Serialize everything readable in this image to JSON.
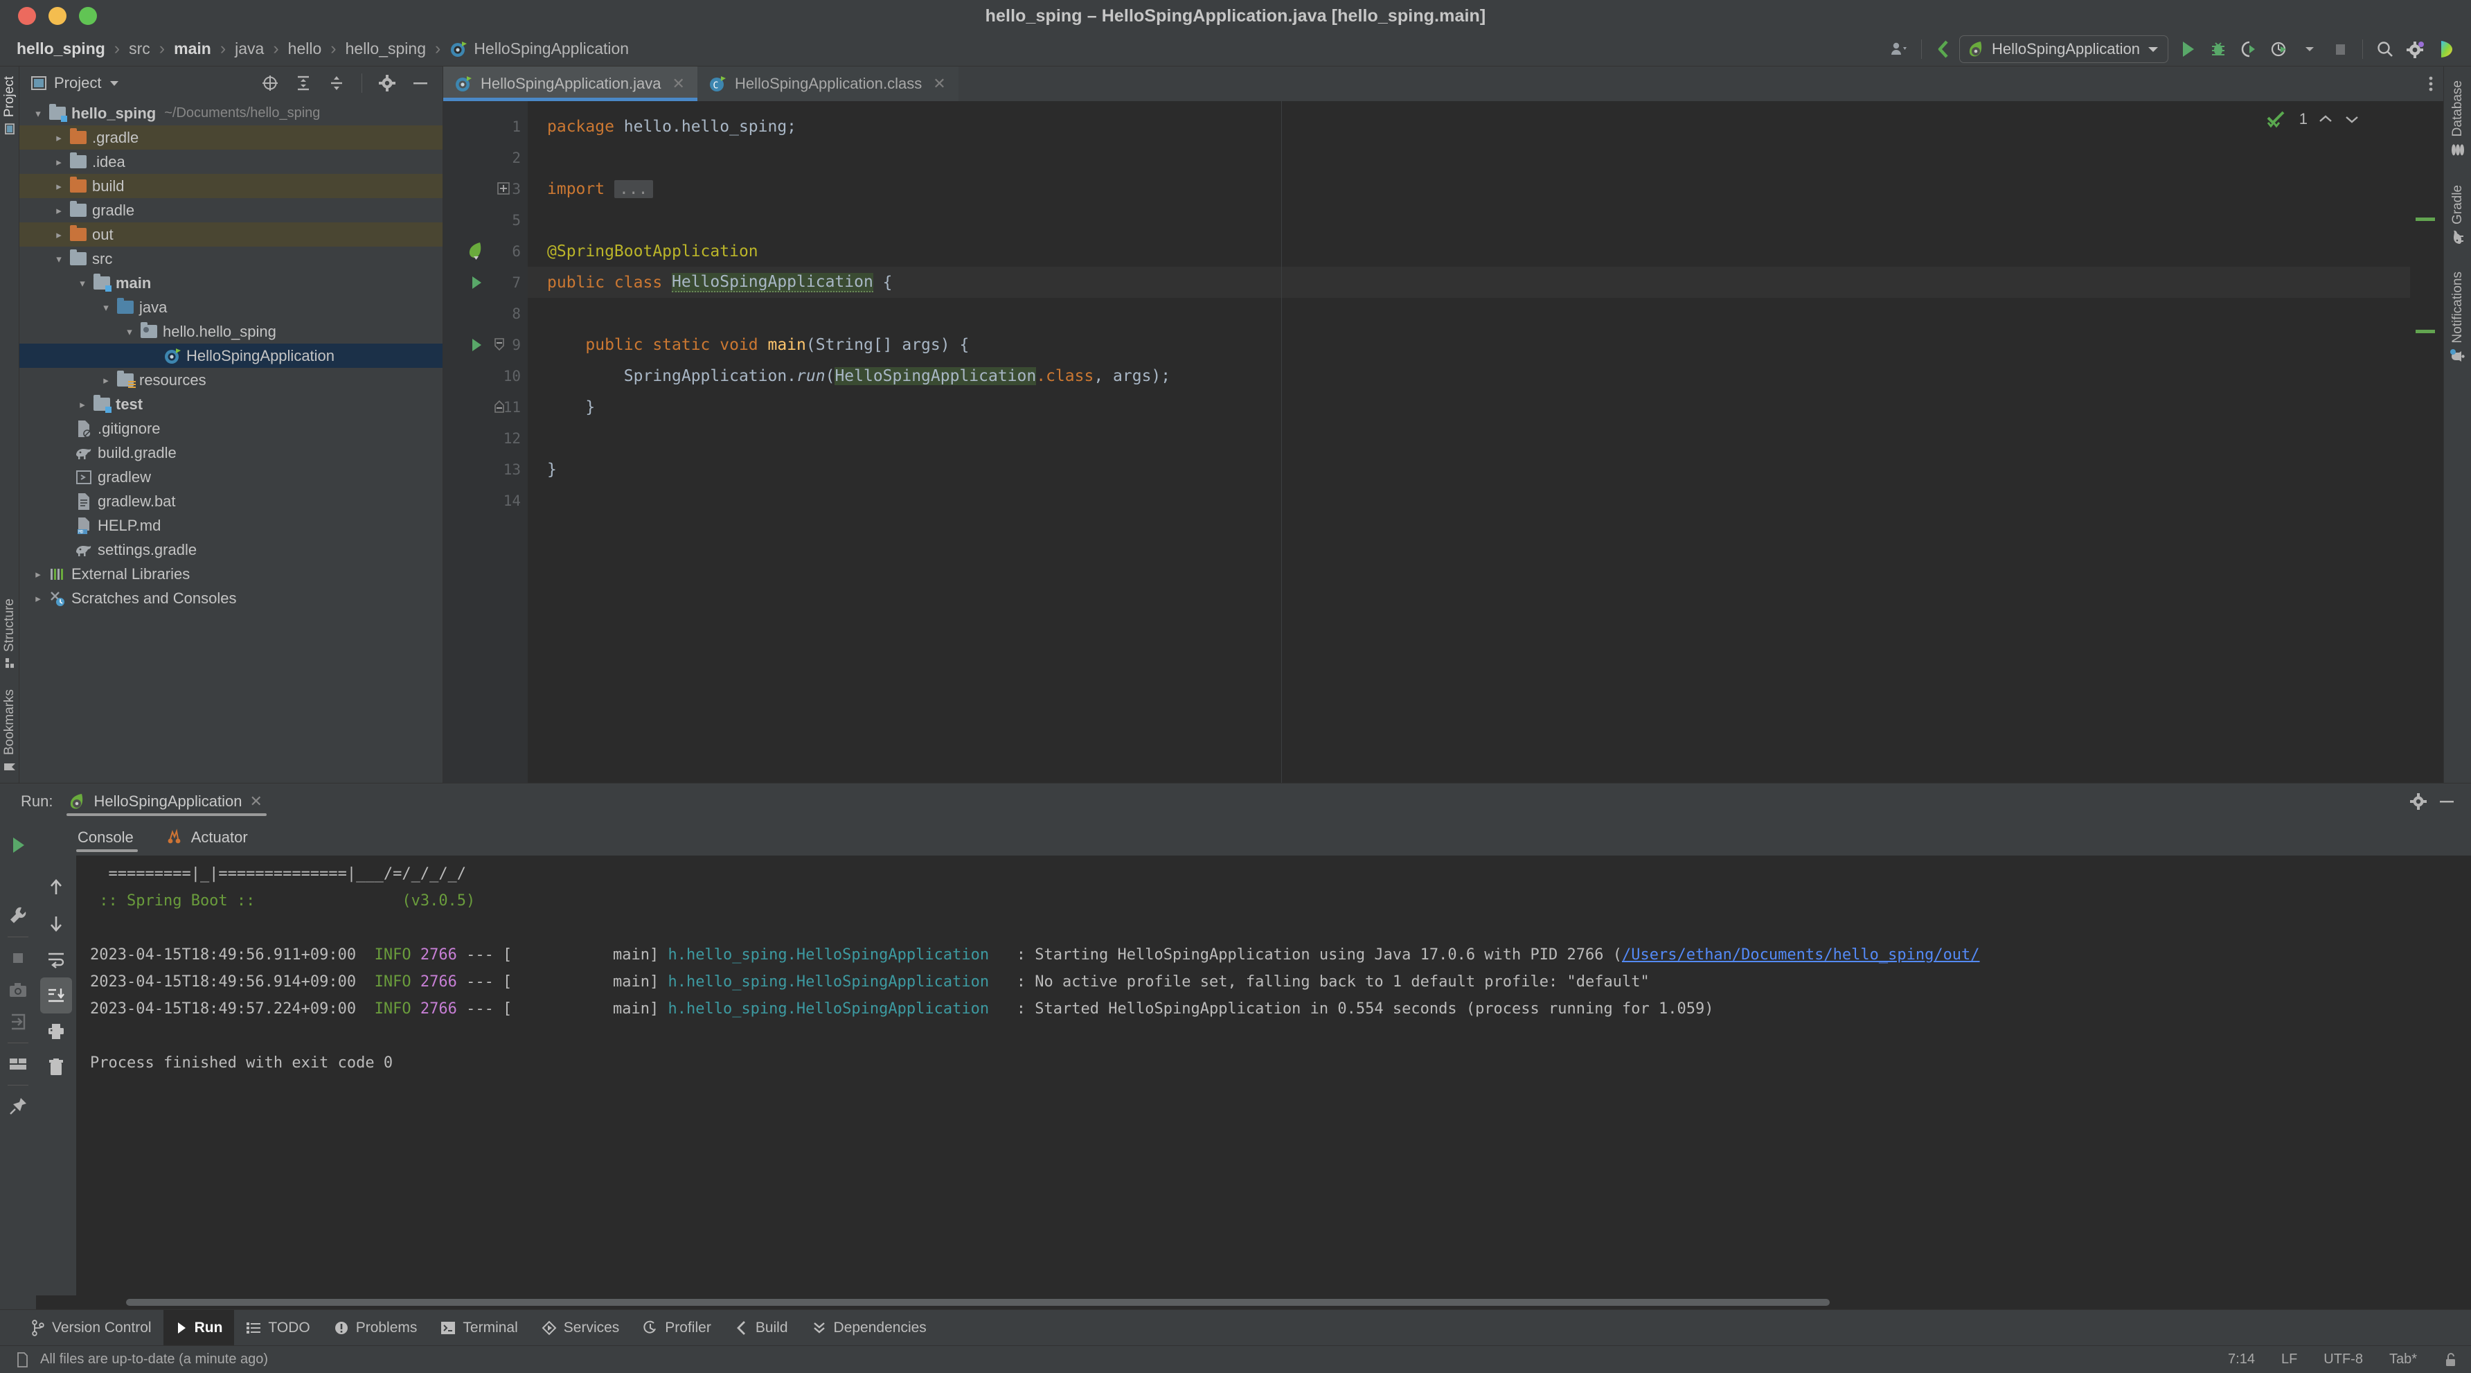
{
  "window": {
    "title": "hello_sping – HelloSpingApplication.java [hello_sping.main]"
  },
  "breadcrumb": {
    "items": [
      {
        "label": "hello_sping",
        "bold": true
      },
      {
        "label": "src",
        "bold": false
      },
      {
        "label": "main",
        "bold": true
      },
      {
        "label": "java",
        "bold": false
      },
      {
        "label": "hello",
        "bold": false
      },
      {
        "label": "hello_sping",
        "bold": false
      },
      {
        "label": "HelloSpingApplication",
        "bold": false,
        "icon": "spring-class-icon"
      }
    ],
    "separator": "›"
  },
  "toolbar": {
    "run_config": "HelloSpingApplication",
    "icons": [
      "account-icon",
      "updates-icon",
      "run-icon",
      "debug-icon",
      "run-with-coverage-icon",
      "profiler-icon",
      "stop-icon",
      "search-icon",
      "settings-icon",
      "ai-assistant-icon"
    ]
  },
  "project_panel": {
    "title": "Project",
    "header_icons": [
      "select-opened-file-icon",
      "expand-all-icon",
      "collapse-all-icon",
      "gear-icon",
      "hide-icon"
    ],
    "tree": [
      {
        "label": "hello_sping",
        "path": "~/Documents/hello_sping",
        "indent": 0,
        "arrow": "down",
        "icon": "module-folder-icon",
        "bold": true,
        "state": "normal"
      },
      {
        "label": ".gradle",
        "indent": 1,
        "arrow": "right",
        "icon": "excluded-folder-icon",
        "state": "excluded"
      },
      {
        "label": ".idea",
        "indent": 1,
        "arrow": "right",
        "icon": "folder-icon",
        "state": "normal"
      },
      {
        "label": "build",
        "indent": 1,
        "arrow": "right",
        "icon": "excluded-folder-icon",
        "state": "excluded"
      },
      {
        "label": "gradle",
        "indent": 1,
        "arrow": "right",
        "icon": "folder-icon",
        "state": "normal"
      },
      {
        "label": "out",
        "indent": 1,
        "arrow": "right",
        "icon": "excluded-folder-icon",
        "state": "excluded"
      },
      {
        "label": "src",
        "indent": 1,
        "arrow": "down",
        "icon": "folder-icon",
        "state": "normal"
      },
      {
        "label": "main",
        "indent": 2,
        "arrow": "down",
        "icon": "source-root-folder-icon",
        "bold": true,
        "state": "normal"
      },
      {
        "label": "java",
        "indent": 3,
        "arrow": "down",
        "icon": "source-folder-icon",
        "state": "normal"
      },
      {
        "label": "hello.hello_sping",
        "indent": 4,
        "arrow": "down",
        "icon": "package-icon",
        "state": "normal"
      },
      {
        "label": "HelloSpingApplication",
        "indent": 5,
        "arrow": "none",
        "icon": "spring-class-icon",
        "state": "selected"
      },
      {
        "label": "resources",
        "indent": 3,
        "arrow": "right",
        "icon": "resource-folder-icon",
        "state": "normal"
      },
      {
        "label": "test",
        "indent": 2,
        "arrow": "right",
        "icon": "test-root-folder-icon",
        "bold": true,
        "state": "normal"
      },
      {
        "label": ".gitignore",
        "indent": 2,
        "arrow": "none",
        "icon": "gitignore-file-icon",
        "state": "normal"
      },
      {
        "label": "build.gradle",
        "indent": 2,
        "arrow": "none",
        "icon": "gradle-file-icon",
        "state": "normal"
      },
      {
        "label": "gradlew",
        "indent": 2,
        "arrow": "none",
        "icon": "shell-script-icon",
        "state": "normal"
      },
      {
        "label": "gradlew.bat",
        "indent": 2,
        "arrow": "none",
        "icon": "bat-file-icon",
        "state": "normal"
      },
      {
        "label": "HELP.md",
        "indent": 2,
        "arrow": "none",
        "icon": "markdown-file-icon",
        "state": "normal"
      },
      {
        "label": "settings.gradle",
        "indent": 2,
        "arrow": "none",
        "icon": "gradle-file-icon",
        "state": "normal"
      },
      {
        "label": "External Libraries",
        "indent": 0,
        "arrow": "right",
        "icon": "libraries-icon",
        "state": "normal"
      },
      {
        "label": "Scratches and Consoles",
        "indent": 0,
        "arrow": "right",
        "icon": "scratches-icon",
        "state": "normal"
      }
    ]
  },
  "editor": {
    "tabs": [
      {
        "label": "HelloSpingApplication.java",
        "active": true,
        "icon": "spring-class-icon"
      },
      {
        "label": "HelloSpingApplication.class",
        "active": false,
        "icon": "class-file-icon"
      }
    ],
    "inspection_count": "1",
    "inspection_icon": "inspections-ok-icon",
    "line_numbers": [
      "1",
      "2",
      "3",
      "5",
      "6",
      "7",
      "8",
      "9",
      "10",
      "11",
      "12",
      "13",
      "14"
    ],
    "lines": [
      {
        "n": "1",
        "type": "package"
      },
      {
        "n": "2",
        "type": "blank"
      },
      {
        "n": "3",
        "type": "import"
      },
      {
        "n": "5",
        "type": "blank"
      },
      {
        "n": "6",
        "type": "annotation"
      },
      {
        "n": "7",
        "type": "classdecl"
      },
      {
        "n": "8",
        "type": "blank"
      },
      {
        "n": "9",
        "type": "maindecl"
      },
      {
        "n": "10",
        "type": "runcall"
      },
      {
        "n": "11",
        "type": "closebrace-indent"
      },
      {
        "n": "12",
        "type": "blank"
      },
      {
        "n": "13",
        "type": "closebrace"
      },
      {
        "n": "14",
        "type": "blank"
      }
    ],
    "text": {
      "package_kw": "package",
      "package_name": " hello.hello_sping;",
      "import_kw": "import",
      "import_fold": "...",
      "annotation": "@SpringBootApplication",
      "class_public": "public class ",
      "class_name": "HelloSpingApplication",
      "class_brace": " {",
      "main_modifiers": "public static void ",
      "main_name": "main",
      "main_params": "(String[] args) {",
      "run_receiver": "SpringApplication.",
      "run_method": "run",
      "run_open": "(",
      "run_arg_class": "HelloSpingApplication",
      "run_dot_class": ".class",
      "run_rest": ", args);",
      "brace_indent": "}",
      "brace_end": "}"
    }
  },
  "right_strip": {
    "items": [
      {
        "label": "Database",
        "icon": "database-icon"
      },
      {
        "label": "Gradle",
        "icon": "gradle-elephant-icon"
      },
      {
        "label": "Notifications",
        "icon": "notifications-bell-icon"
      }
    ]
  },
  "left_strip": {
    "items": [
      {
        "label": "Project",
        "icon": "project-icon",
        "active": true
      },
      {
        "label": "Bookmarks",
        "icon": "bookmarks-icon",
        "active": false
      },
      {
        "label": "Structure",
        "icon": "structure-icon",
        "active": false
      }
    ]
  },
  "run_panel": {
    "label": "Run:",
    "config_name": "HelloSpingApplication",
    "close_icon": "close-icon",
    "tabs": [
      {
        "label": "Console",
        "active": true,
        "icon": null
      },
      {
        "label": "Actuator",
        "active": false,
        "icon": "actuator-icon"
      }
    ],
    "header_icons": [
      "settings-gear-icon",
      "hide-icon"
    ],
    "side_icons": [
      "rerun-icon"
    ],
    "left_tools": [
      "wrench-icon",
      "stop-icon",
      "camera-icon",
      "export-icon",
      "layout-icon",
      "pin-icon"
    ],
    "console_tools": [
      "scroll-up-icon",
      "scroll-down-icon",
      "soft-wrap-icon",
      "scroll-to-end-icon",
      "print-icon",
      "clear-all-icon"
    ]
  },
  "console": {
    "banner_line1": "  =========|_|==============|___/=/_/_/_/",
    "banner_line2": " :: Spring Boot ::                (v3.0.5)",
    "logs": [
      {
        "timestamp": "2023-04-15T18:49:56.911+09:00",
        "level": "INFO",
        "pid": "2766",
        "dashes": "--- [",
        "thread": "           main]",
        "logger": " h.hello_sping.HelloSpingApplication",
        "sep": "   : ",
        "message": "Starting HelloSpingApplication using Java 17.0.6 with PID 2766 (",
        "link": "/Users/ethan/Documents/hello_sping/out/"
      },
      {
        "timestamp": "2023-04-15T18:49:56.914+09:00",
        "level": "INFO",
        "pid": "2766",
        "dashes": "--- [",
        "thread": "           main]",
        "logger": " h.hello_sping.HelloSpingApplication",
        "sep": "   : ",
        "message": "No active profile set, falling back to 1 default profile: \"default\"",
        "link": ""
      },
      {
        "timestamp": "2023-04-15T18:49:57.224+09:00",
        "level": "INFO",
        "pid": "2766",
        "dashes": "--- [",
        "thread": "           main]",
        "logger": " h.hello_sping.HelloSpingApplication",
        "sep": "   : ",
        "message": "Started HelloSpingApplication in 0.554 seconds (process running for 1.059)",
        "link": ""
      }
    ],
    "exit_message": "Process finished with exit code 0"
  },
  "toolwindow_bar": {
    "items": [
      {
        "label": "Version Control",
        "icon": "version-control-icon",
        "active": false
      },
      {
        "label": "Run",
        "icon": "run-triangle-icon",
        "active": true
      },
      {
        "label": "TODO",
        "icon": "todo-icon",
        "active": false
      },
      {
        "label": "Problems",
        "icon": "problems-icon",
        "active": false
      },
      {
        "label": "Terminal",
        "icon": "terminal-icon",
        "active": false
      },
      {
        "label": "Services",
        "icon": "services-icon",
        "active": false
      },
      {
        "label": "Profiler",
        "icon": "profiler-icon",
        "active": false
      },
      {
        "label": "Build",
        "icon": "build-icon",
        "active": false
      },
      {
        "label": "Dependencies",
        "icon": "dependencies-icon",
        "active": false
      }
    ]
  },
  "statusbar": {
    "message": "All files are up-to-date (a minute ago)",
    "message_icon": "file-status-icon",
    "caret": "7:14",
    "line_separator": "LF",
    "encoding": "UTF-8",
    "indent": "Tab*",
    "lock_icon": "unlocked-icon"
  },
  "colors": {
    "accent_blue": "#4a88c7",
    "selection_blue": "#1b3048",
    "excluded_olive": "#4a4632",
    "keyword_orange": "#cc7832",
    "annotation_yellow": "#bbb529",
    "string_green": "#6a8759",
    "method_gold": "#ffc66d",
    "console_bg": "#2b2b2b",
    "panel_bg": "#3c3f41"
  }
}
